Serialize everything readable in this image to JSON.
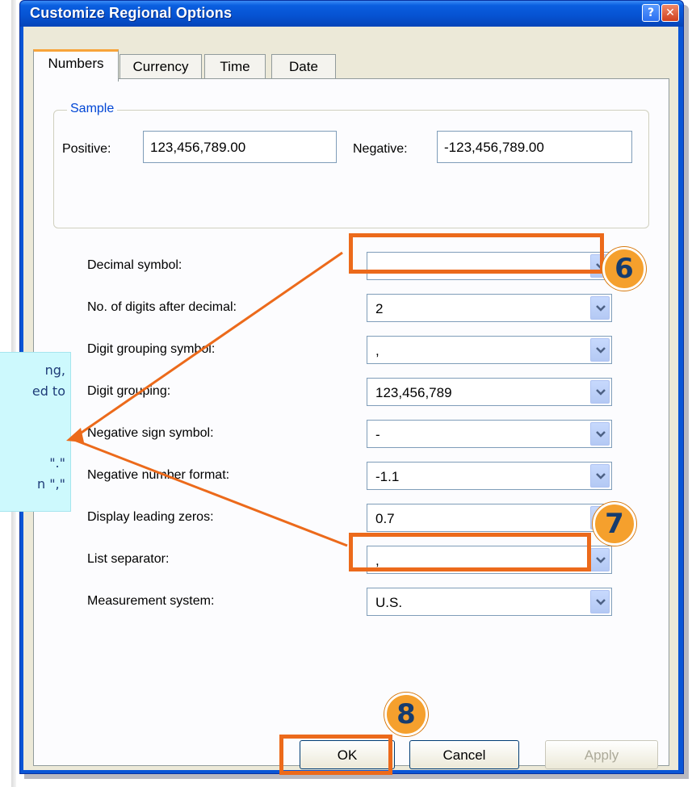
{
  "window": {
    "title": "Customize Regional Options"
  },
  "tabs": [
    {
      "label": "Numbers",
      "active": true
    },
    {
      "label": "Currency",
      "active": false
    },
    {
      "label": "Time",
      "active": false
    },
    {
      "label": "Date",
      "active": false
    }
  ],
  "sample": {
    "legend": "Sample",
    "positive_label": "Positive:",
    "positive_value": "123,456,789.00",
    "negative_label": "Negative:",
    "negative_value": "-123,456,789.00"
  },
  "settings": [
    {
      "label": "Decimal symbol:",
      "value": "."
    },
    {
      "label": "No. of digits after decimal:",
      "value": "2"
    },
    {
      "label": "Digit grouping symbol:",
      "value": ","
    },
    {
      "label": "Digit grouping:",
      "value": "123,456,789"
    },
    {
      "label": "Negative sign symbol:",
      "value": "-"
    },
    {
      "label": "Negative number format:",
      "value": "-1.1"
    },
    {
      "label": "Display leading zeros:",
      "value": "0.7"
    },
    {
      "label": "List separator:",
      "value": ","
    },
    {
      "label": "Measurement system:",
      "value": "U.S."
    }
  ],
  "buttons": {
    "ok": "OK",
    "cancel": "Cancel",
    "apply": "Apply"
  },
  "callout": {
    "lines": [
      "ng,",
      "ed to",
      "\".\"",
      "n \",\""
    ]
  },
  "annotations": {
    "step6": "6",
    "step7": "7",
    "step8": "8",
    "color": "#ec6a1b"
  }
}
